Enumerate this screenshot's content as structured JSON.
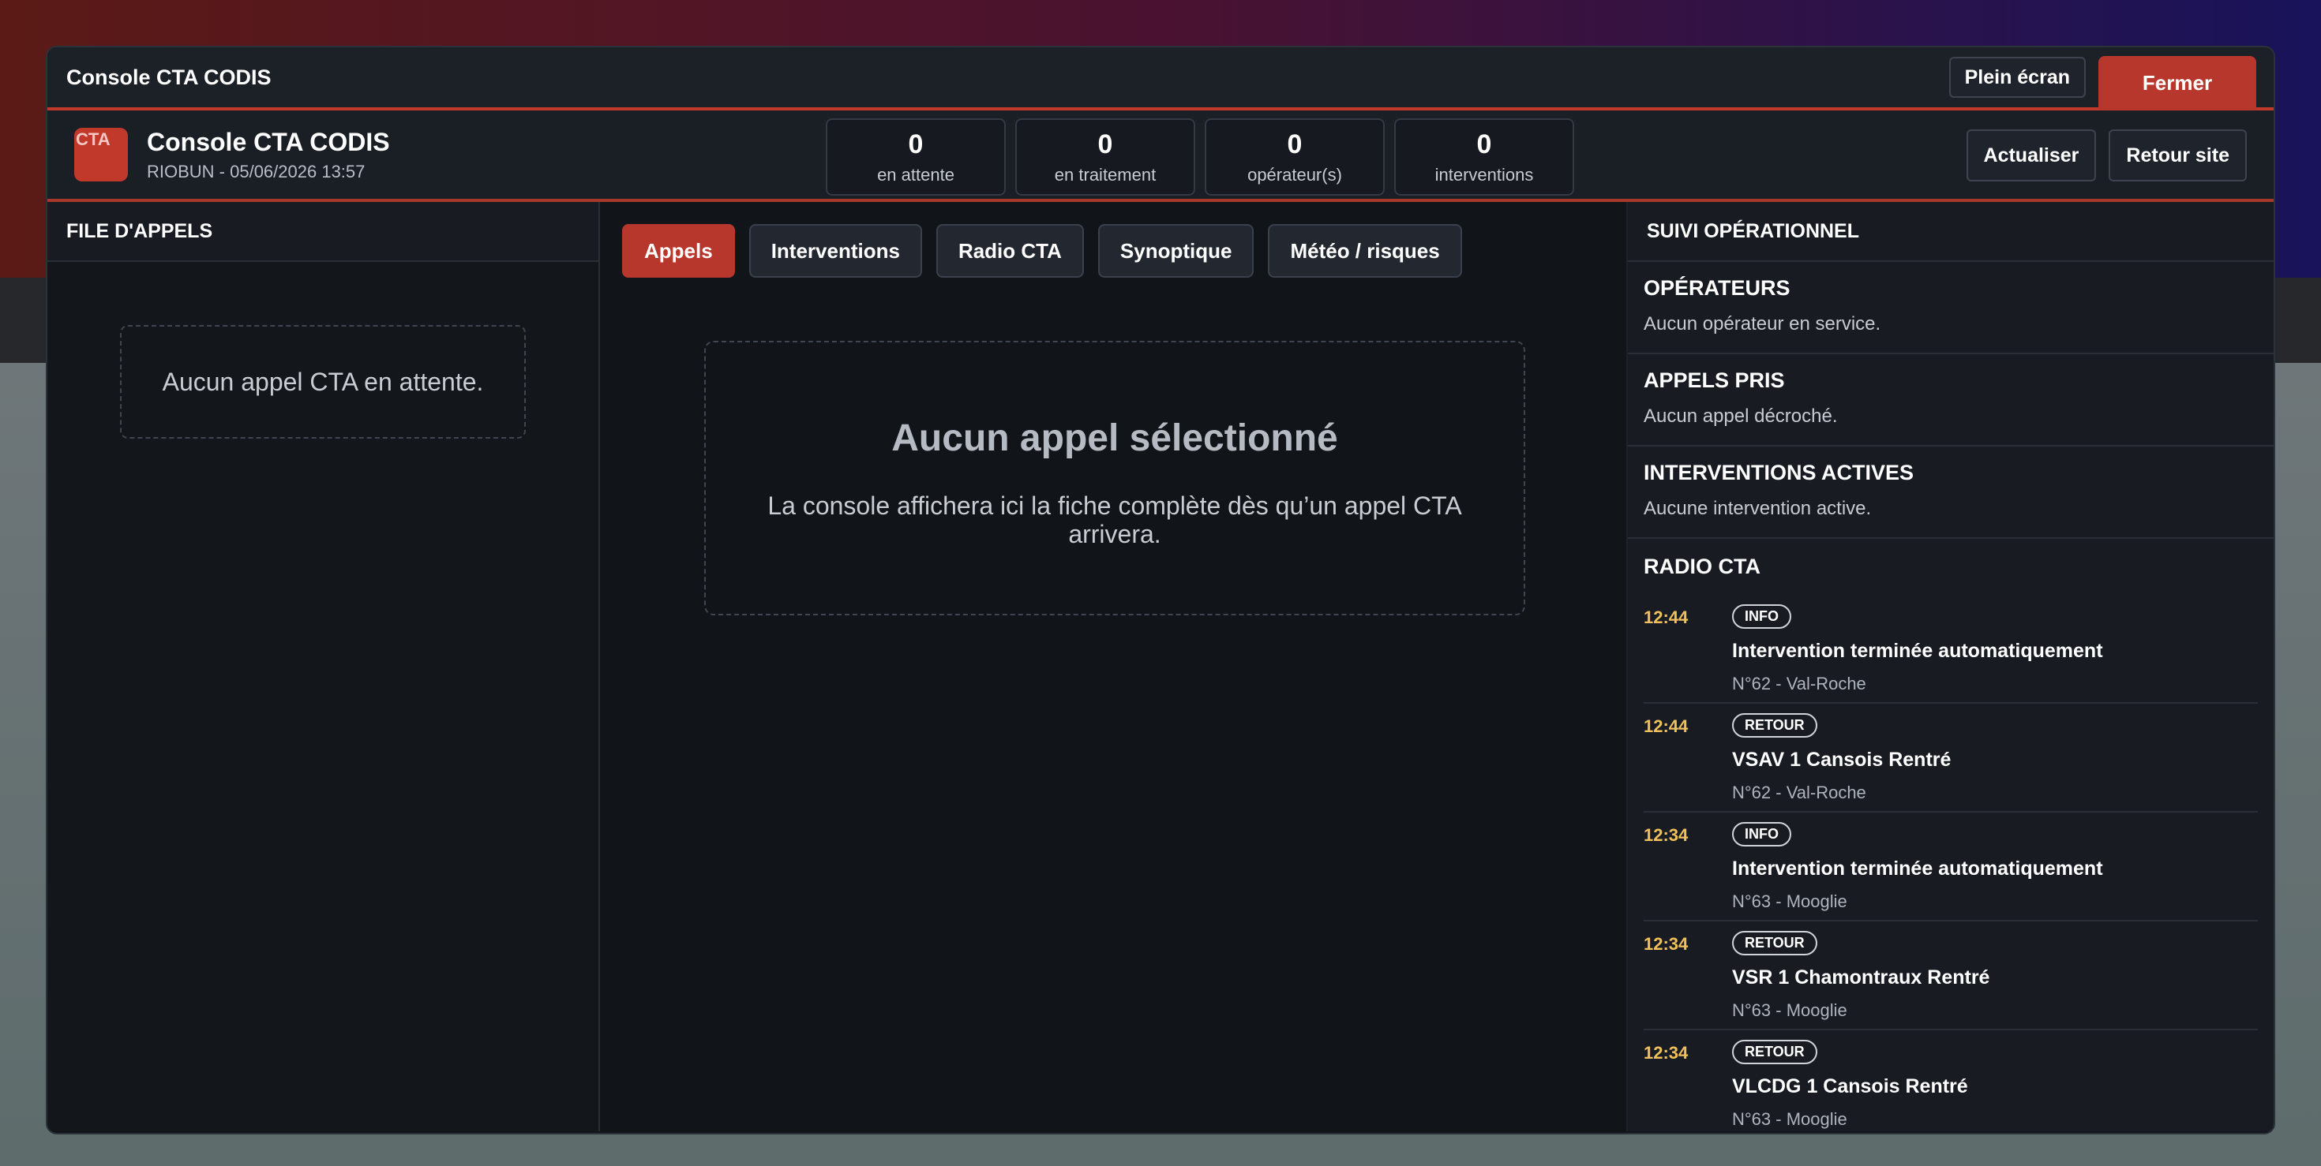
{
  "window": {
    "title": "Console CTA CODIS",
    "fullscreen_label": "Plein écran",
    "close_label": "Fermer"
  },
  "header": {
    "logo_text": "CTA",
    "name": "Console CTA CODIS",
    "subtitle": "RIOBUN - 05/06/2026 13:57",
    "stats": [
      {
        "value": "0",
        "label": "en attente"
      },
      {
        "value": "0",
        "label": "en traitement"
      },
      {
        "value": "0",
        "label": "opérateur(s)"
      },
      {
        "value": "0",
        "label": "interventions"
      }
    ],
    "refresh_label": "Actualiser",
    "back_label": "Retour site"
  },
  "call_queue": {
    "title": "FILE D'APPELS",
    "empty_text": "Aucun appel CTA en attente."
  },
  "tabs": [
    {
      "label": "Appels",
      "active": true
    },
    {
      "label": "Interventions",
      "active": false
    },
    {
      "label": "Radio CTA",
      "active": false
    },
    {
      "label": "Synoptique",
      "active": false
    },
    {
      "label": "Météo / risques",
      "active": false
    }
  ],
  "main": {
    "empty_title": "Aucun appel sélectionné",
    "empty_text": "La console affichera ici la fiche complète dès qu’un appel CTA arrivera."
  },
  "ops": {
    "title": "SUIVI OPÉRATIONNEL",
    "operators": {
      "title": "OPÉRATEURS",
      "text": "Aucun opérateur en service."
    },
    "calls_taken": {
      "title": "APPELS PRIS",
      "text": "Aucun appel décroché."
    },
    "active_interventions": {
      "title": "INTERVENTIONS ACTIVES",
      "text": "Aucune intervention active."
    },
    "radio": {
      "title": "RADIO CTA",
      "items": [
        {
          "time": "12:44",
          "badge": "INFO",
          "headline": "Intervention terminée automatiquement",
          "location": "N°62 - Val-Roche"
        },
        {
          "time": "12:44",
          "badge": "RETOUR",
          "headline": "VSAV 1 Cansois Rentré",
          "location": "N°62 - Val-Roche"
        },
        {
          "time": "12:34",
          "badge": "INFO",
          "headline": "Intervention terminée automatiquement",
          "location": "N°63 - Mooglie"
        },
        {
          "time": "12:34",
          "badge": "RETOUR",
          "headline": "VSR 1 Chamontraux Rentré",
          "location": "N°63 - Mooglie"
        },
        {
          "time": "12:34",
          "badge": "RETOUR",
          "headline": "VLCDG 1 Cansois Rentré",
          "location": "N°63 - Mooglie"
        }
      ]
    }
  },
  "colors": {
    "accent": "#c0392b",
    "time": "#f0c05a",
    "surface": "#111418"
  }
}
